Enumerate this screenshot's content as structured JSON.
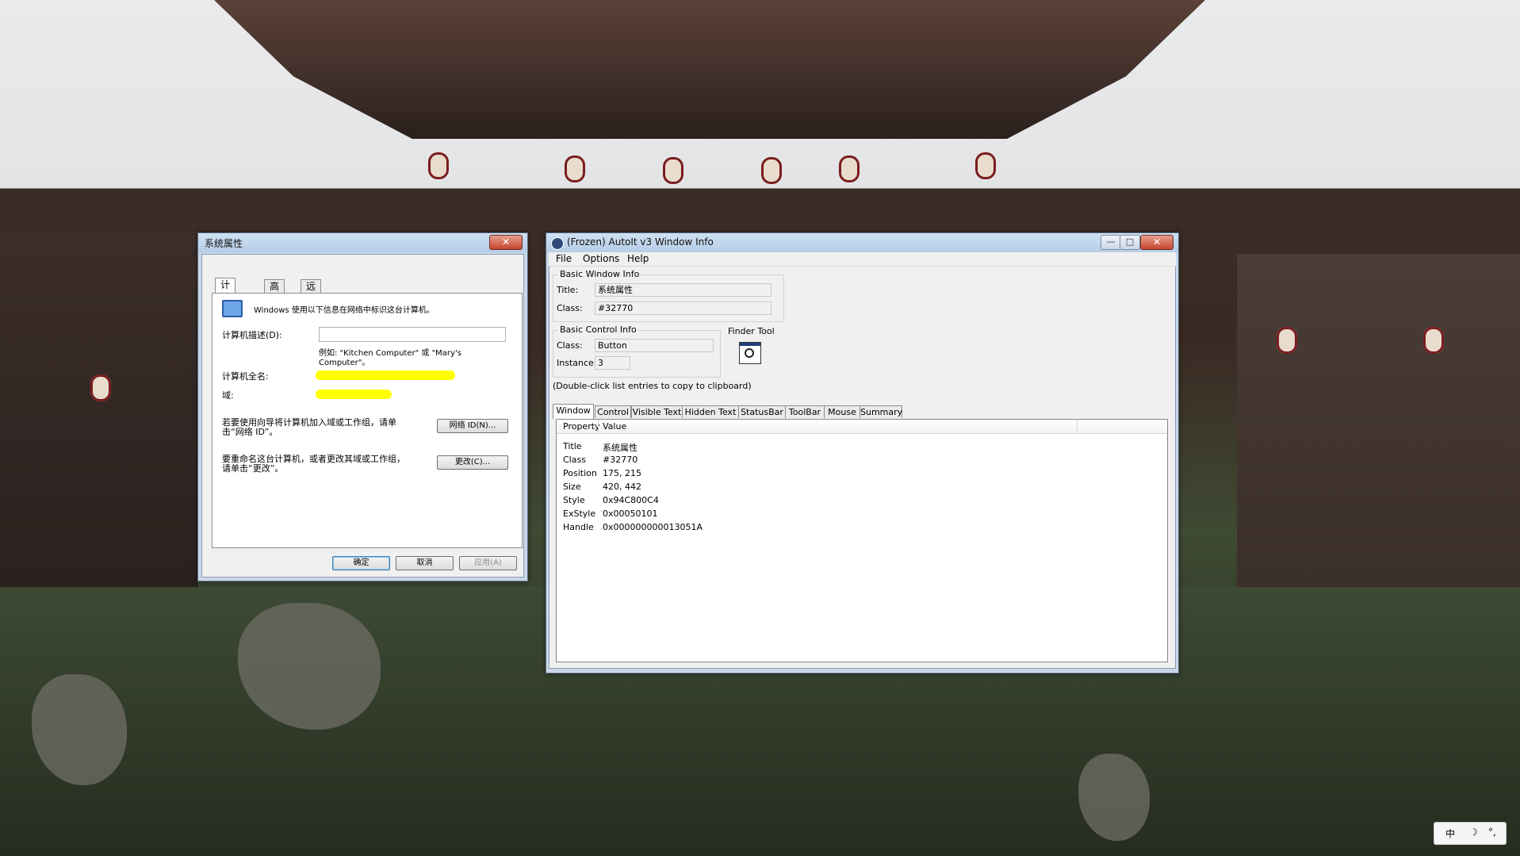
{
  "system_properties": {
    "title": "系统属性",
    "close_glyph": "✕",
    "tabs": [
      {
        "label": "计算机名",
        "active": true
      },
      {
        "label": "高级",
        "active": false
      },
      {
        "label": "远程",
        "active": false
      }
    ],
    "intro_text": "Windows 使用以下信息在网络中标识这台计算机。",
    "description_label": "计算机描述(D):",
    "description_value": "",
    "example_text_line1": "例如: \"Kitchen Computer\" 或 \"Mary's",
    "example_text_line2": "Computer\"。",
    "full_name_label": "计算机全名:",
    "domain_label": "域:",
    "network_id_text_line1": "若要使用向导将计算机加入域或工作组，请单",
    "network_id_text_line2": "击“网络 ID”。",
    "network_id_button": "网络 ID(N)...",
    "rename_text_line1": "要重命名这台计算机，或者更改其域或工作组，",
    "rename_text_line2": "请单击“更改”。",
    "change_button": "更改(C)...",
    "ok_button": "确定",
    "cancel_button": "取消",
    "apply_button": "应用(A)",
    "redaction_color": "#ffff00"
  },
  "autoit_info": {
    "title": "(Frozen) AutoIt v3 Window Info",
    "minimize_glyph": "—",
    "maximize_glyph": "□",
    "close_glyph": "✕",
    "menu": [
      "File",
      "Options",
      "Help"
    ],
    "basic_window_info": {
      "group_label": "Basic Window Info",
      "title_label": "Title:",
      "title_value": "系统属性",
      "class_label": "Class:",
      "class_value": "#32770"
    },
    "basic_control_info": {
      "group_label": "Basic Control Info",
      "class_label": "Class:",
      "class_value": "Button",
      "instance_label": "Instance:",
      "instance_value": "3"
    },
    "finder_tool_label": "Finder Tool",
    "hint": "(Double-click list entries to copy to clipboard)",
    "tabs": [
      "Window",
      "Control",
      "Visible Text",
      "Hidden Text",
      "StatusBar",
      "ToolBar",
      "Mouse",
      "Summary"
    ],
    "active_tab": "Window",
    "list_headers": {
      "property": "Property",
      "value": "Value"
    },
    "rows": [
      {
        "property": "Title",
        "value": "系统属性"
      },
      {
        "property": "Class",
        "value": "#32770"
      },
      {
        "property": "Position",
        "value": "175, 215"
      },
      {
        "property": "Size",
        "value": "420, 442"
      },
      {
        "property": "Style",
        "value": "0x94C800C4"
      },
      {
        "property": "ExStyle",
        "value": "0x00050101"
      },
      {
        "property": "Handle",
        "value": "0x000000000013051A"
      }
    ]
  },
  "tray": {
    "ime": "中",
    "moon": "☽",
    "punct": "°,"
  }
}
